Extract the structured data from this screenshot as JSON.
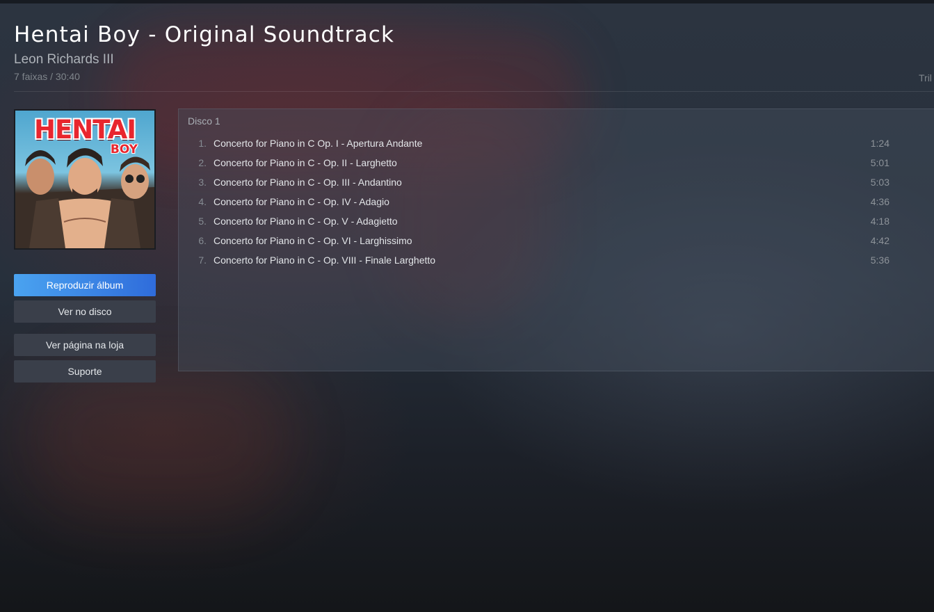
{
  "album": {
    "title": "Hentai Boy - Original Soundtrack",
    "artist": "Leon Richards III",
    "meta": "7 faixas / 30:40",
    "meta_right": "Tril"
  },
  "cover": {
    "title_text": "HENTAI",
    "sub_text": "BOY"
  },
  "buttons": {
    "play_album": "Reproduzir álbum",
    "view_on_disk": "Ver no disco",
    "view_store_page": "Ver página na loja",
    "support": "Suporte"
  },
  "tracklist": {
    "disc_label": "Disco 1",
    "tracks": [
      {
        "num": "1.",
        "name": "Concerto for Piano in C Op. I - Apertura Andante",
        "duration": "1:24"
      },
      {
        "num": "2.",
        "name": "Concerto for Piano in C - Op. II - Larghetto",
        "duration": "5:01"
      },
      {
        "num": "3.",
        "name": "Concerto for Piano in C - Op. III - Andantino",
        "duration": "5:03"
      },
      {
        "num": "4.",
        "name": "Concerto for Piano in C - Op. IV - Adagio",
        "duration": "4:36"
      },
      {
        "num": "5.",
        "name": "Concerto for Piano in C - Op. V - Adagietto",
        "duration": "4:18"
      },
      {
        "num": "6.",
        "name": "Concerto for Piano in C - Op. VI - Larghissimo",
        "duration": "4:42"
      },
      {
        "num": "7.",
        "name": "Concerto for Piano in C - Op. VIII - Finale Larghetto",
        "duration": "5:36"
      }
    ]
  },
  "colors": {
    "primary_button_start": "#4aa3f0",
    "primary_button_end": "#2f6cdb",
    "secondary_button": "#3a3f4a",
    "cover_title": "#e8262e"
  }
}
